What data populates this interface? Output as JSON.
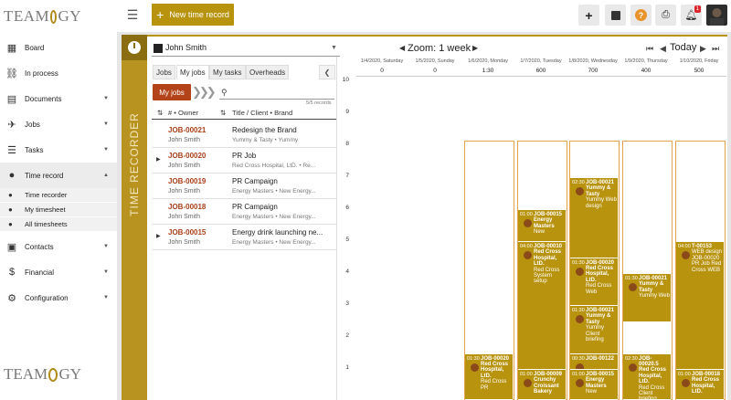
{
  "app": {
    "logo_text": "TEAMOGY"
  },
  "topbar": {
    "new_record_label": "New time record",
    "notifications_count": "1",
    "icons": [
      "plus-icon",
      "notes-icon",
      "help-icon",
      "print-icon",
      "bell-icon"
    ]
  },
  "sidebar": {
    "items": [
      {
        "label": "Board",
        "icon": "grid-icon"
      },
      {
        "label": "In process",
        "icon": "flow-icon"
      },
      {
        "label": "Documents",
        "icon": "document-icon"
      },
      {
        "label": "Jobs",
        "icon": "rocket-icon"
      },
      {
        "label": "Tasks",
        "icon": "tasks-icon"
      },
      {
        "label": "Time record",
        "icon": "clock-icon"
      },
      {
        "label": "Contacts",
        "icon": "contacts-icon"
      },
      {
        "label": "Financial",
        "icon": "dollar-icon"
      },
      {
        "label": "Configuration",
        "icon": "gear-icon"
      }
    ],
    "time_sub": [
      "Time recorder",
      "My timesheet",
      "All timesheets"
    ]
  },
  "recorder": {
    "strip_label": "TIME RECORDER",
    "user": "John Smith",
    "tabs": [
      "Jobs",
      "My jobs",
      "My tasks",
      "Overheads"
    ],
    "filter_pill": "My jobs",
    "records": "5/5 records",
    "columns": {
      "number": "# • Owner",
      "title": "Title / Client • Brand"
    },
    "rows": [
      {
        "job": "JOB-00021",
        "owner": "John Smith",
        "title": "Redesign the Brand",
        "client": "Yummy & Tasty • Yummy",
        "expandable": false
      },
      {
        "job": "JOB-00020",
        "owner": "John Smith",
        "title": "PR Job",
        "client": "Red Cross Hospital, LtD. • Re...",
        "expandable": true
      },
      {
        "job": "JOB-00019",
        "owner": "John Smith",
        "title": "PR Campaign",
        "client": "Energy Masters • New Energy...",
        "expandable": false
      },
      {
        "job": "JOB-00018",
        "owner": "John Smith",
        "title": "PR Campaign",
        "client": "Energy Masters • New Energy...",
        "expandable": false
      },
      {
        "job": "JOB-00015",
        "owner": "John Smith",
        "title": "Energy drink launching ne...",
        "client": "Energy Masters • New Energy...",
        "expandable": true
      }
    ]
  },
  "calendar": {
    "zoom_label": "Zoom: 1 week",
    "today_label": "Today",
    "days": [
      {
        "date": "1/4/2020, Saturday",
        "total": "0"
      },
      {
        "date": "1/5/2020, Sunday",
        "total": "0"
      },
      {
        "date": "1/6/2020, Monday",
        "total": "1:30"
      },
      {
        "date": "1/7/2020, Tuesday",
        "total": "600"
      },
      {
        "date": "1/8/2020, Wednesday",
        "total": "700"
      },
      {
        "date": "1/9/2020, Thursday",
        "total": "400"
      },
      {
        "date": "1/10/2020, Friday",
        "total": "500"
      }
    ],
    "hours": [
      "10",
      "9",
      "8",
      "7",
      "6",
      "5",
      "4",
      "3",
      "2",
      "1"
    ],
    "events": [
      {
        "day": 2,
        "start": 0,
        "end": 1.5,
        "time": "01:30",
        "title": "JOB-00020 Red Cross Hospital, LtD.",
        "sub": "Red Cross PR"
      },
      {
        "day": 3,
        "start": 0,
        "end": 1,
        "time": "01:00",
        "title": "JOB-00009 Crunchy Croissant Bakery",
        "sub": ""
      },
      {
        "day": 3,
        "start": 1,
        "end": 5,
        "time": "04:00",
        "title": "JOB-00010 Red Cross Hospital, LtD.",
        "sub": "Red Cross System setup"
      },
      {
        "day": 3,
        "start": 5,
        "end": 6,
        "time": "01:00",
        "title": "JOB-00015 Energy Masters",
        "sub": "New"
      },
      {
        "day": 4,
        "start": 0,
        "end": 1,
        "time": "01:00",
        "title": "JOB-00015 Energy Masters",
        "sub": "New"
      },
      {
        "day": 4,
        "start": 1,
        "end": 1.5,
        "time": "00:30",
        "title": "JOB-00122",
        "sub": ""
      },
      {
        "day": 4,
        "start": 1.5,
        "end": 3,
        "time": "01:30",
        "title": "JOB-00021 Yummy & Tasty",
        "sub": "Yummy Client briefing"
      },
      {
        "day": 4,
        "start": 3,
        "end": 4.5,
        "time": "01:30",
        "title": "JOB-00020 Red Cross Hospital, LtD.",
        "sub": "Red Cross Web"
      },
      {
        "day": 4,
        "start": 4.5,
        "end": 7,
        "time": "02:30",
        "title": "JOB-00021 Yummy & Tasty",
        "sub": "Yummy Web design"
      },
      {
        "day": 5,
        "start": 0,
        "end": 1.5,
        "time": "02:30",
        "title": "JOB-00020.5 Red Cross Hospital, LtD.",
        "sub": "Red Cross Client briefing"
      },
      {
        "day": 5,
        "start": 2.5,
        "end": 4,
        "time": "01:30",
        "title": "JOB-00021 Yummy & Tasty",
        "sub": "Yummy Web"
      },
      {
        "day": 6,
        "start": 0,
        "end": 1,
        "time": "01:00",
        "title": "JOB-00018 Red Cross Hospital, LtD.",
        "sub": ""
      },
      {
        "day": 6,
        "start": 1,
        "end": 5,
        "time": "04:00",
        "title": "T-00153",
        "sub": "WEB design JOB-00020 PR Job Red Cross WEB"
      }
    ]
  },
  "colors": {
    "accent": "#b8930e",
    "job_red": "#a8401a",
    "column_border": "#e3a24b"
  }
}
